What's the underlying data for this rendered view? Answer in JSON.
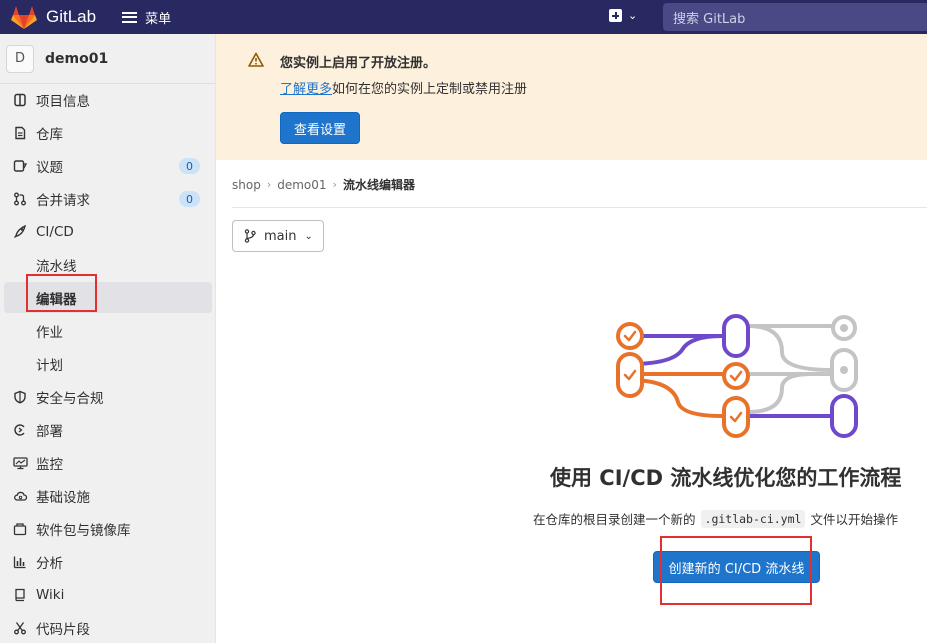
{
  "topbar": {
    "brand": "GitLab",
    "menu_label": "菜单",
    "search_placeholder": "搜索 GitLab"
  },
  "sidebar": {
    "project_avatar": "D",
    "project_name": "demo01",
    "items": [
      {
        "label": "项目信息",
        "icon": "info-icon"
      },
      {
        "label": "仓库",
        "icon": "doc-icon"
      },
      {
        "label": "议题",
        "icon": "issues-icon",
        "badge": "0"
      },
      {
        "label": "合并请求",
        "icon": "merge-request-icon",
        "badge": "0"
      },
      {
        "label": "CI/CD",
        "icon": "rocket-icon"
      },
      {
        "label": "流水线"
      },
      {
        "label": "编辑器"
      },
      {
        "label": "作业"
      },
      {
        "label": "计划"
      },
      {
        "label": "安全与合规",
        "icon": "shield-icon"
      },
      {
        "label": "部署",
        "icon": "deploy-icon"
      },
      {
        "label": "监控",
        "icon": "monitor-icon"
      },
      {
        "label": "基础设施",
        "icon": "cloud-icon"
      },
      {
        "label": "软件包与镜像库",
        "icon": "package-icon"
      },
      {
        "label": "分析",
        "icon": "chart-icon"
      },
      {
        "label": "Wiki",
        "icon": "book-icon"
      },
      {
        "label": "代码片段",
        "icon": "snippet-icon"
      }
    ]
  },
  "alert": {
    "title": "您实例上启用了开放注册。",
    "link": "了解更多",
    "desc": "如何在您的实例上定制或禁用注册",
    "button": "查看设置"
  },
  "breadcrumb": [
    "shop",
    "demo01",
    "流水线编辑器"
  ],
  "branch": "main",
  "empty_state": {
    "title": "使用 CI/CD 流水线优化您的工作流程",
    "desc_prefix": "在仓库的根目录创建一个新的",
    "desc_code": ".gitlab-ci.yml",
    "desc_suffix": "文件以开始操作",
    "button": "创建新的 CI/CD 流水线"
  },
  "colors": {
    "nav_bg": "#292961",
    "primary": "#1f75cb",
    "alert_bg": "#fdf1dd",
    "orange": "#e9722b",
    "purple": "#6e49cb",
    "highlight": "#e0302f"
  }
}
